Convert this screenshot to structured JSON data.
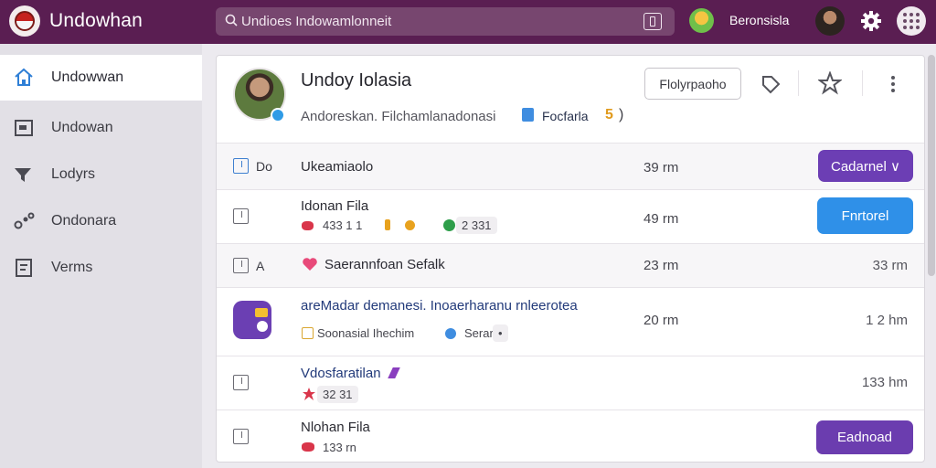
{
  "app": {
    "title": "Undowhan"
  },
  "search": {
    "placeholder": "Undioes Indowamlonneit"
  },
  "header": {
    "user_name": "Beronsisla"
  },
  "sidebar": {
    "items": [
      {
        "label": "Undowwan",
        "icon": "home-icon",
        "active": true
      },
      {
        "label": "Undowan",
        "icon": "inbox-icon",
        "active": false
      },
      {
        "label": "Lodyrs",
        "icon": "filter-icon",
        "active": false
      },
      {
        "label": "Ondonara",
        "icon": "share-icon",
        "active": false
      },
      {
        "label": "Verms",
        "icon": "document-icon",
        "active": false
      }
    ]
  },
  "card": {
    "title": "Undoy Iolasia",
    "subtitle": "Andoreskan. Filchamlanadonasi",
    "tag": "Focfarla",
    "count": "5",
    "count_suffix": ")",
    "action_button": "Flolyrpaoho"
  },
  "rows": [
    {
      "check_label": "Do",
      "title": "Ukeamiaolo",
      "time": "39 rm",
      "button": "Cadarnel ∨"
    },
    {
      "title": "Idonan Fila",
      "pill1": "433 1 1",
      "pill2": "2 331",
      "time": "49 rm",
      "button": "Fnrtorel"
    },
    {
      "check_label": "A",
      "title": "Saerannfoan Sefalk",
      "time": "23 rm",
      "time_right": "33 rm"
    },
    {
      "title": "areMadar demanesi. Inoaerharanu rnleerotea",
      "sub": "Soonasial Ihechim",
      "sub_tag": "Serar",
      "sub_tag_suffix": "•",
      "time": "20 rm",
      "time_right": "1 2 hm"
    },
    {
      "title": "Vdosfaratilan",
      "pill1": "32 31",
      "time_right": "133 hm"
    },
    {
      "title": "Nlohan Fila",
      "pill1": "133 rn",
      "button": "Eadnoad"
    }
  ],
  "colors": {
    "topbar": "#5a1e52",
    "accent_purple": "#6c3eb4",
    "accent_blue": "#2f90e8"
  }
}
